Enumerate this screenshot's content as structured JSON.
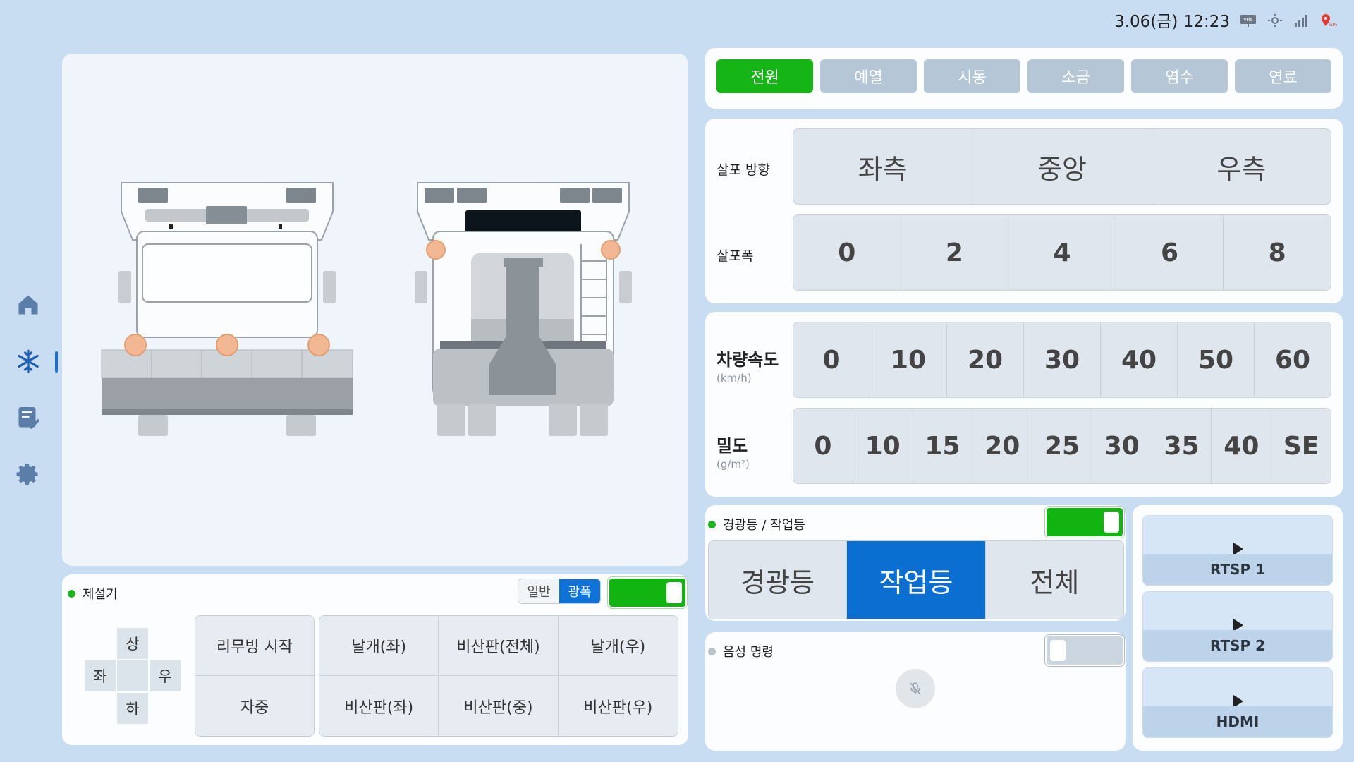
{
  "status": {
    "clock": "3.06(금) 12:23",
    "icons": [
      "vms-icon",
      "sun-icon",
      "signal-icon",
      "gps-icon"
    ]
  },
  "nav": [
    "home-icon",
    "snowflake-icon",
    "checklist-icon",
    "gear-icon"
  ],
  "plow": {
    "title": "제설기",
    "mode_options": [
      "일반",
      "광폭"
    ],
    "mode_selected": "광폭",
    "toggle_on": true,
    "dpad": {
      "up": "상",
      "down": "하",
      "left": "좌",
      "right": "우"
    },
    "buttons": {
      "reset_start": "리무빙 시작",
      "self_weight": "자중",
      "wing_left": "날개(좌)",
      "deflector_all": "비산판(전체)",
      "wing_right": "날개(우)",
      "deflector_left": "비산판(좌)",
      "deflector_center": "비산판(중)",
      "deflector_right": "비산판(우)"
    }
  },
  "tabs": [
    {
      "label": "전원",
      "active": true
    },
    {
      "label": "예열",
      "active": false
    },
    {
      "label": "시동",
      "active": false
    },
    {
      "label": "소금",
      "active": false
    },
    {
      "label": "염수",
      "active": false
    },
    {
      "label": "연료",
      "active": false
    }
  ],
  "spray": {
    "direction_label": "살포 방향",
    "directions": [
      "좌측",
      "중앙",
      "우측"
    ],
    "width_label": "살포폭",
    "widths": [
      "0",
      "2",
      "4",
      "6",
      "8"
    ]
  },
  "speed": {
    "label": "차량속도",
    "unit": "(km/h)",
    "values": [
      "0",
      "10",
      "20",
      "30",
      "40",
      "50",
      "60"
    ]
  },
  "density": {
    "label": "밀도",
    "unit": "(g/m²)",
    "values": [
      "0",
      "10",
      "15",
      "20",
      "25",
      "30",
      "35",
      "40",
      "SE"
    ]
  },
  "lights": {
    "title": "경광등 / 작업등",
    "toggle_on": true,
    "options": [
      "경광등",
      "작업등",
      "전체"
    ],
    "selected": "작업등"
  },
  "voice": {
    "title": "음성 명령",
    "toggle_on": false
  },
  "streams": [
    "RTSP 1",
    "RTSP 2",
    "HDMI"
  ],
  "colors": {
    "accent_green": "#14b514",
    "accent_blue": "#0b6fd1",
    "background": "#c8dcf2"
  }
}
